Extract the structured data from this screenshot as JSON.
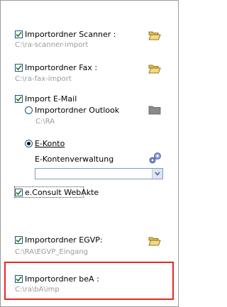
{
  "scanner": {
    "label": "Importordner Scanner :",
    "path": "C:\\ra-scanner-import",
    "checked": true
  },
  "fax": {
    "label": "Importordner Fax :",
    "path": "C:\\ra-fax-import",
    "checked": true
  },
  "email": {
    "label": "Import E-Mail",
    "checked": true,
    "outlook": {
      "label": "Importordner Outlook",
      "path": "C:\\RA",
      "selected": false
    },
    "ekonto": {
      "label": "E-Konto",
      "selected": true,
      "verwaltung_label": "E-Kontenverwaltung",
      "dropdown_value": ""
    }
  },
  "econsult": {
    "label": "e.Consult WebAkte",
    "checked": true
  },
  "egvp": {
    "label": "Importordner EGVP:",
    "path": "C:\\RA\\EGVP_Eingang",
    "checked": true
  },
  "bea": {
    "label": "Importordner beA :",
    "path": "C:\\ra\\bA\\imp",
    "checked": true
  },
  "colors": {
    "highlight": "#e32b22",
    "path_text": "#9a9a9a",
    "checkbox_border": "#1c5180"
  },
  "icons": {
    "folder": "folder-open-icon",
    "settings": "gears-icon",
    "dropdown": "chevron-down-icon"
  }
}
